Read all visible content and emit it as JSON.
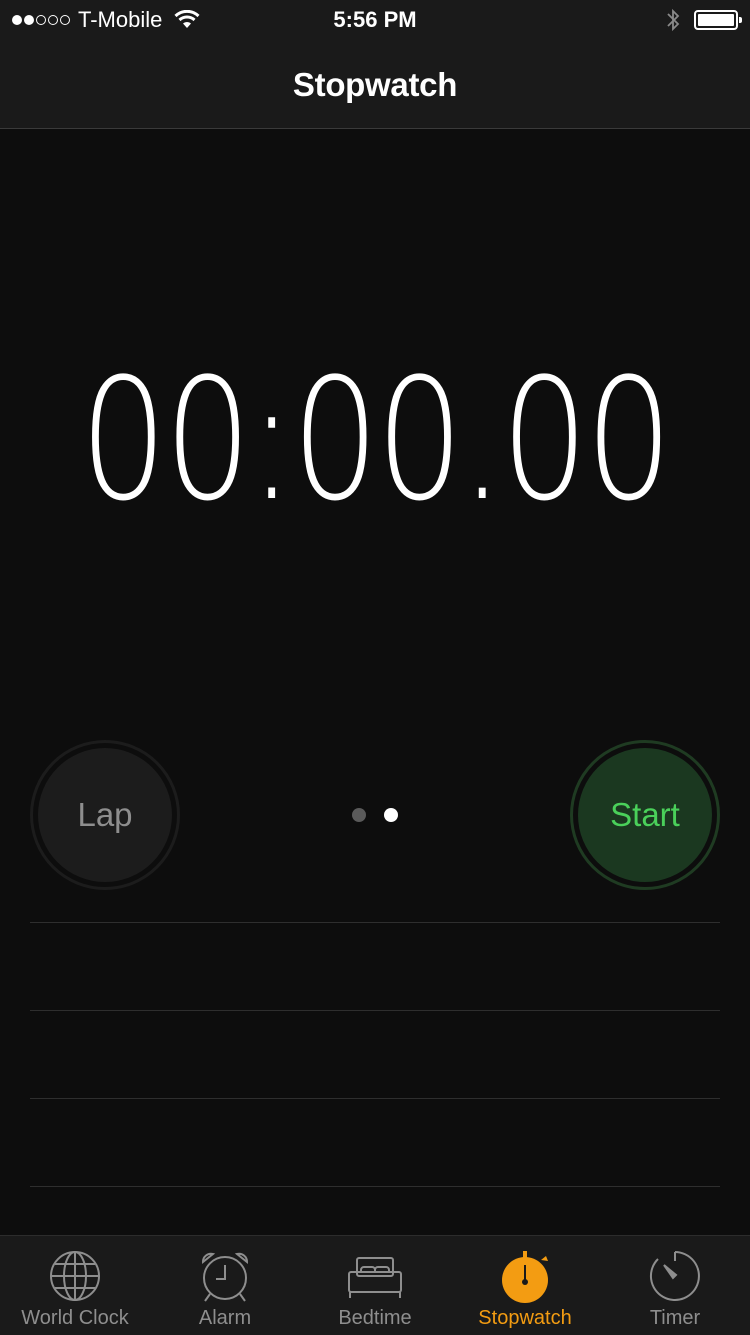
{
  "status_bar": {
    "signal_bars_filled": 2,
    "signal_bars_total": 5,
    "carrier": "T-Mobile",
    "time": "5:56 PM",
    "battery_level": 1.0
  },
  "nav": {
    "title": "Stopwatch"
  },
  "stopwatch": {
    "display": "00:00.00"
  },
  "buttons": {
    "lap_label": "Lap",
    "start_label": "Start"
  },
  "page_indicator": {
    "count": 2,
    "active_index": 1
  },
  "lap_rows": 4,
  "tabs": [
    {
      "label": "World Clock",
      "icon": "globe-icon",
      "active": false
    },
    {
      "label": "Alarm",
      "icon": "alarm-clock-icon",
      "active": false
    },
    {
      "label": "Bedtime",
      "icon": "bed-icon",
      "active": false
    },
    {
      "label": "Stopwatch",
      "icon": "stopwatch-icon",
      "active": true
    },
    {
      "label": "Timer",
      "icon": "timer-icon",
      "active": false
    }
  ],
  "colors": {
    "accent_active_tab": "#f39c12",
    "start_text": "#4ad05a",
    "start_bg": "#1b3820",
    "lap_text": "#8e8e8e",
    "inactive_tab": "#8e8e8e"
  }
}
